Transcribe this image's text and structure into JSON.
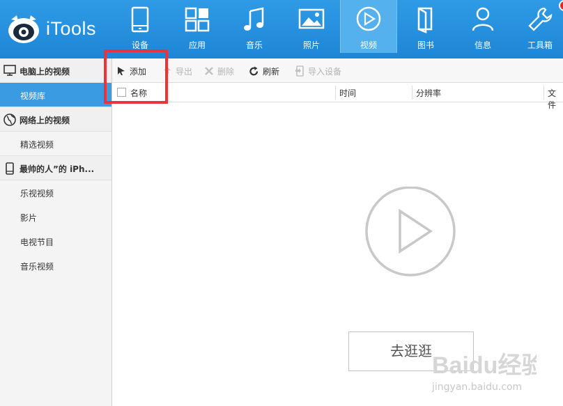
{
  "app": {
    "name": "iTools"
  },
  "nav": [
    {
      "label": "设备",
      "icon": "phone-icon"
    },
    {
      "label": "应用",
      "icon": "apps-icon"
    },
    {
      "label": "音乐",
      "icon": "music-icon"
    },
    {
      "label": "照片",
      "icon": "photo-icon"
    },
    {
      "label": "视频",
      "icon": "video-play-icon",
      "active": true
    },
    {
      "label": "图书",
      "icon": "book-icon"
    },
    {
      "label": "信息",
      "icon": "person-icon"
    },
    {
      "label": "工具箱",
      "icon": "wrench-icon"
    }
  ],
  "sidebar": {
    "sections": [
      {
        "title": "电脑上的视频",
        "icon": "monitor-icon",
        "items": [
          "视频库"
        ]
      },
      {
        "title": "网络上的视频",
        "icon": "globe-icon",
        "items": [
          "精选视频"
        ]
      },
      {
        "title": "最帅的人”的 iPh...",
        "icon": "device-icon",
        "items": [
          "乐视视频",
          "影片",
          "电视节目",
          "音乐视频"
        ]
      }
    ],
    "active_item": "视频库"
  },
  "toolbar": {
    "add": "添加",
    "export": "导出",
    "delete": "删除",
    "refresh": "刷新",
    "import_device": "导入设备"
  },
  "columns": {
    "name": "名称",
    "time": "时间",
    "resolution": "分辨率",
    "file": "文件"
  },
  "empty_state": {
    "button": "去逛逛"
  },
  "watermark": {
    "brand": "Baidu经验",
    "url": "jingyan.baidu.com"
  },
  "colors": {
    "topbar": "#1d86d6",
    "active_nav": "#55b0ee",
    "sidebar_active": "#3a9ae2",
    "highlight": "#e8343a"
  }
}
